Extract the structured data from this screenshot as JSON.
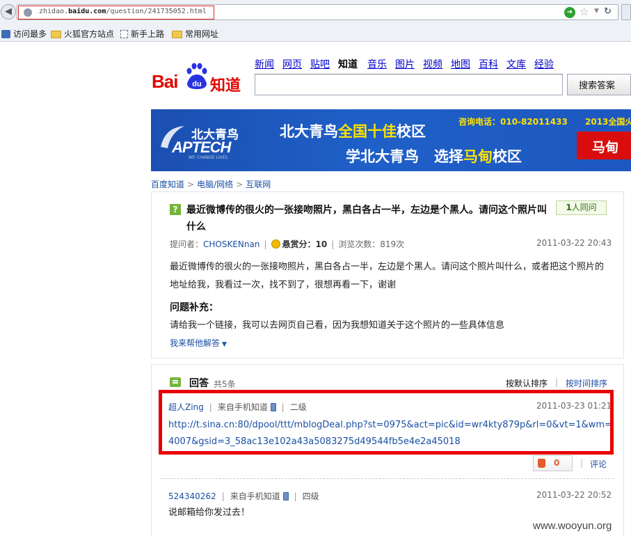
{
  "browser": {
    "url_prefix": "zhidao.",
    "url_domain": "baidu.com",
    "url_path": "/question/241735052.html",
    "bookmarks": [
      "访问最多",
      "火狐官方站点",
      "新手上路",
      "常用网址"
    ]
  },
  "top_nav": [
    "新闻",
    "网页",
    "贴吧",
    "知道",
    "音乐",
    "图片",
    "视频",
    "地图",
    "百科",
    "文库",
    "经验"
  ],
  "top_nav_current": "知道",
  "logo": {
    "bai": "Bai",
    "du": "du",
    "zhidao": "知道"
  },
  "search": {
    "value": "",
    "button_label": "搜索答案"
  },
  "banner": {
    "logo_top": "北大青鸟",
    "logo_bottom": "APTECH",
    "logo_small": "WE CHANGE LIVES",
    "line1_prefix": "北大青鸟",
    "line1_highlight": "全国十佳",
    "line1_suffix": "校区",
    "line2_prefix": "学北大青鸟   选择",
    "line2_highlight": "马甸",
    "line2_suffix": "校区",
    "phone": "咨询电话：010-82011433",
    "year": "2013全国火",
    "tag": "马甸"
  },
  "breadcrumb": [
    "百度知道",
    "电脑/网络",
    "互联网"
  ],
  "question": {
    "title": "最近微博传的很火的一张接吻照片，黑白各占一半，左边是个黑人。请问这个照片叫什么",
    "same_count": "1",
    "same_label": "人同问",
    "asker_label": "提问者：",
    "asker": "CHOSKENnan",
    "reward_label": "悬赏分：10",
    "views": "浏览次数：819次",
    "time": "2011-03-22 20:43",
    "body": "最近微博传的很火的一张接吻照片，黑白各占一半，左边是个黑人。请问这个照片叫什么，或者把这个照片的地址给我，我看过一次，找不到了，很想再看一下，谢谢",
    "supplement_title": "问题补充：",
    "supplement_body": "请给我一个链接，我可以去网页自己看，因为我想知道关于这个照片的一些具体信息",
    "help_label": "我来帮他解答"
  },
  "answers": {
    "title": "回答",
    "count": "共5条",
    "sort_default": "按默认排序",
    "sort_time": "按时间排序",
    "items": [
      {
        "user": "超人Zing",
        "source": "来自手机知道",
        "level": "二级",
        "time": "2011-03-23 01:21",
        "text": "http://t.sina.cn:80/dpool/ttt/mblogDeal.php?st=0975&act=pic&id=wr4kty879p&rl=0&vt=1&wm=4007&gsid=3_58ac13e102a43a5083275d49544fb5e4e2a45018",
        "likes": "0",
        "comment_label": "评论"
      },
      {
        "user": "524340262",
        "source": "来自手机知道",
        "level": "四级",
        "time": "2011-03-22 20:52",
        "text": "说邮箱给你发过去！"
      }
    ]
  },
  "watermark": "www.wooyun.org"
}
